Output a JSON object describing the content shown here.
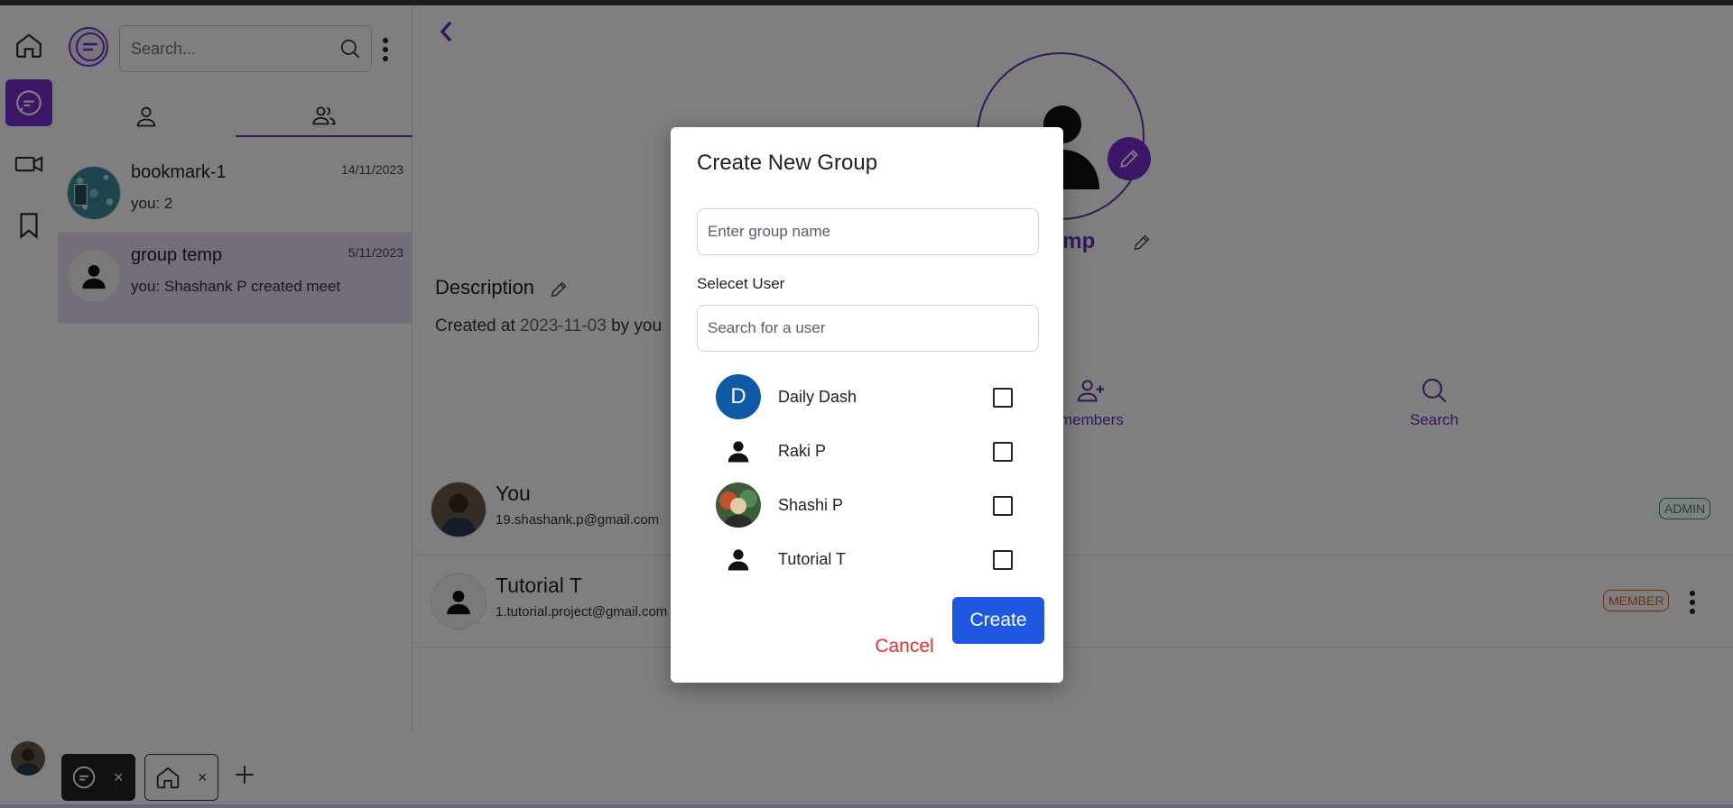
{
  "sidebar": {
    "search_placeholder": "Search...",
    "chats": [
      {
        "name": "bookmark-1",
        "preview": "you: 2",
        "date": "14/11/2023"
      },
      {
        "name": "group temp",
        "preview": "you: Shashank P created meet",
        "date": "5/11/2023"
      }
    ]
  },
  "main": {
    "group_title": "Temp",
    "description_label": "Description",
    "created_prefix": "Created at",
    "created_date": "2023-11-03",
    "created_by": "by you",
    "actions": [
      {
        "label": "members",
        "icon": "add-user-icon"
      },
      {
        "label": "Search",
        "icon": "search-icon"
      }
    ],
    "members": [
      {
        "name": "You",
        "email": "19.shashank.p@gmail.com",
        "role": "ADMIN"
      },
      {
        "name": "Tutorial T",
        "email": "1.tutorial.project@gmail.com",
        "role": "MEMBER"
      }
    ]
  },
  "modal": {
    "title": "Create New Group",
    "group_name_placeholder": "Enter group name",
    "select_user_label": "Selecet User",
    "user_search_placeholder": "Search for a user",
    "users": [
      {
        "name": "Daily Dash",
        "avatar_letter": "D"
      },
      {
        "name": "Raki P"
      },
      {
        "name": "Shashi P"
      },
      {
        "name": "Tutorial T"
      }
    ],
    "cancel_label": "Cancel",
    "create_label": "Create"
  },
  "bottom_tabs": {
    "close_glyph": "×"
  },
  "colors": {
    "accent": "#7a2fcf",
    "primary_button": "#1f57e0",
    "cancel": "#e03131",
    "admin": "#2e8b57",
    "member": "#d9622b"
  }
}
